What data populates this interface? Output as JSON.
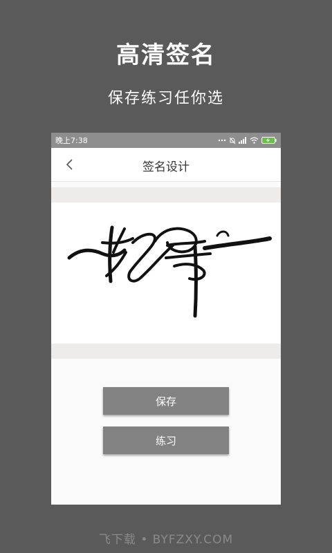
{
  "promo": {
    "headline": "高清签名",
    "subheadline": "保存练习任你选"
  },
  "status_bar": {
    "time": "晚上7:38",
    "icons": [
      "more-dots-icon",
      "alarm-off-icon",
      "signal-icon",
      "wifi-icon",
      "battery-charging-icon"
    ]
  },
  "app_bar": {
    "back_icon": "chevron-left-icon",
    "title": "签名设计"
  },
  "actions": {
    "save_label": "保存",
    "practice_label": "练习"
  },
  "footer": {
    "watermark": "飞下载 • BYFZXY.COM"
  },
  "colors": {
    "background": "#5a5a5a",
    "status_bar": "#8e8e8e",
    "button": "#828282",
    "paper": "#eeeceb"
  }
}
